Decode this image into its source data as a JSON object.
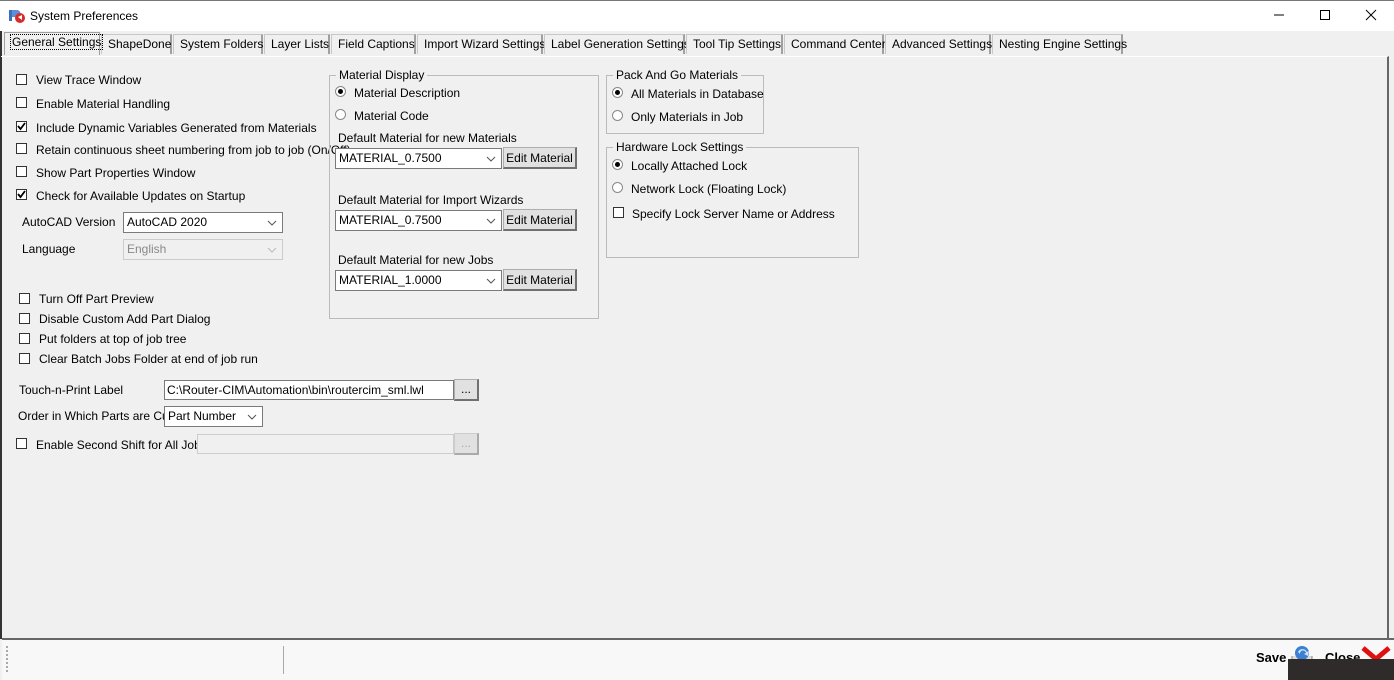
{
  "window": {
    "title": "System Preferences",
    "icon": "rc-app-icon",
    "controls": {
      "minimize": "minimize-icon",
      "maximize": "maximize-icon",
      "close": "close-icon"
    }
  },
  "tabs": [
    {
      "label": "General Settings",
      "active": true
    },
    {
      "label": "ShapeDone",
      "active": false
    },
    {
      "label": "System Folders",
      "active": false
    },
    {
      "label": "Layer Lists",
      "active": false
    },
    {
      "label": "Field Captions",
      "active": false
    },
    {
      "label": "Import Wizard Settings",
      "active": false
    },
    {
      "label": "Label Generation Settings",
      "active": false
    },
    {
      "label": "Tool Tip Settings",
      "active": false
    },
    {
      "label": "Command Center",
      "active": false
    },
    {
      "label": "Advanced Settings",
      "active": false
    },
    {
      "label": "Nesting Engine Settings",
      "active": false
    }
  ],
  "general": {
    "checkboxes_top": [
      {
        "label": "View Trace Window",
        "checked": false
      },
      {
        "label": "Enable Material Handling",
        "checked": false
      },
      {
        "label": "Include Dynamic Variables Generated from Materials",
        "checked": true
      },
      {
        "label": "Retain continuous sheet numbering from job to job (On/Off)",
        "checked": false
      },
      {
        "label": "Show Part Properties Window",
        "checked": false
      },
      {
        "label": "Check for Available Updates on Startup",
        "checked": true
      }
    ],
    "autocad_version": {
      "label": "AutoCAD Version",
      "value": "AutoCAD 2020"
    },
    "language": {
      "label": "Language",
      "value": "English",
      "disabled": true
    },
    "checkboxes_bottom": [
      {
        "label": "Turn Off Part Preview",
        "checked": false
      },
      {
        "label": "Disable Custom Add Part Dialog",
        "checked": false
      },
      {
        "label": "Put folders at top of job tree",
        "checked": false
      },
      {
        "label": "Clear Batch Jobs Folder at end of job run",
        "checked": false
      }
    ],
    "touch_n_print": {
      "label": "Touch-n-Print Label",
      "value": "C:\\Router-CIM\\Automation\\bin\\routercim_sml.lwl",
      "browse": "..."
    },
    "cut_order": {
      "label": "Order in Which Parts are Cut",
      "value": "Part Number"
    },
    "second_shift": {
      "label": "Enable Second Shift for All Jobs",
      "checked": false,
      "value": "",
      "browse": "..."
    }
  },
  "material_display": {
    "title": "Material Display",
    "options": [
      {
        "label": "Material Description",
        "selected": true
      },
      {
        "label": "Material Code",
        "selected": false
      }
    ],
    "defaults": [
      {
        "label": "Default Material for new Materials",
        "value": "MATERIAL_0.7500",
        "button": "Edit Material"
      },
      {
        "label": "Default Material for Import Wizards",
        "value": "MATERIAL_0.7500",
        "button": "Edit Material"
      },
      {
        "label": "Default Material for new Jobs",
        "value": "MATERIAL_1.0000",
        "button": "Edit Material"
      }
    ]
  },
  "pack_and_go": {
    "title": "Pack And Go Materials",
    "options": [
      {
        "label": "All Materials in Database",
        "selected": true
      },
      {
        "label": "Only Materials in Job",
        "selected": false
      }
    ]
  },
  "hardware_lock": {
    "title": "Hardware Lock Settings",
    "options": [
      {
        "label": "Locally Attached Lock",
        "selected": true
      },
      {
        "label": "Network Lock (Floating Lock)",
        "selected": false
      }
    ],
    "specify_server": {
      "label": "Specify Lock Server Name or Address",
      "checked": false
    }
  },
  "footer": {
    "save_label": "Save",
    "close_label": "Close"
  }
}
